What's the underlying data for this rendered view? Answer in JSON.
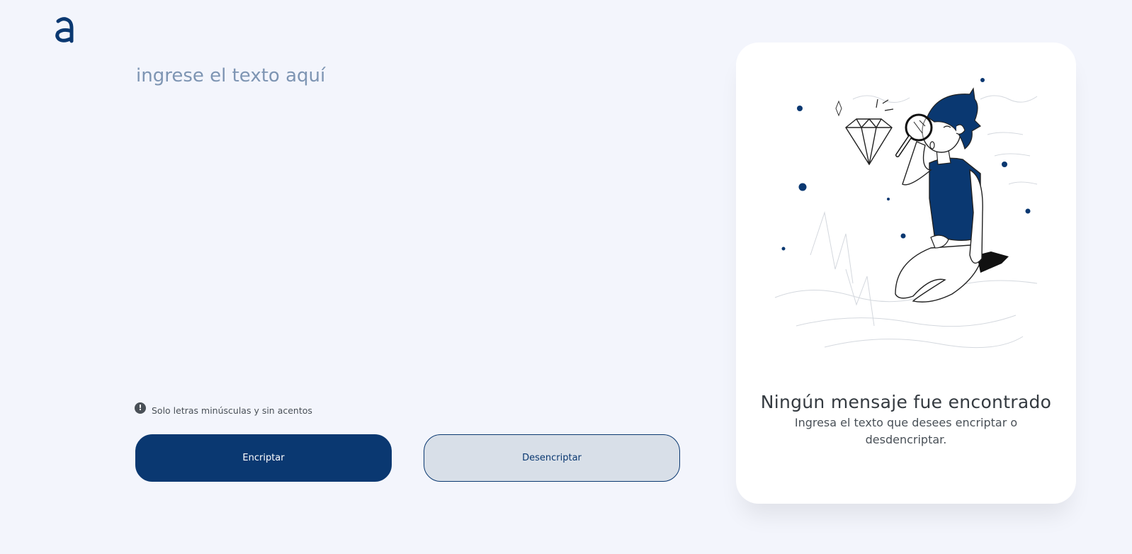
{
  "brand": {
    "logo_letter": "a",
    "logo_icon": "alura-logo-icon",
    "color": "#0a3871"
  },
  "input": {
    "placeholder": "ingrese el texto aquí",
    "value": ""
  },
  "hint": {
    "icon": "exclamation-circle-icon",
    "text": "Solo letras minúsculas y sin acentos"
  },
  "buttons": {
    "encrypt_label": "Encriptar",
    "decrypt_label": "Desencriptar"
  },
  "output": {
    "illustration": "person-with-magnifying-glass-and-diamond-illustration",
    "title": "Ningún mensaje fue encontrado",
    "subtitle": "Ingresa el texto que desees encriptar o desdencriptar."
  },
  "colors": {
    "background": "#f3f5fc",
    "primary": "#0a3871",
    "secondary_button_bg": "#d8dfe8",
    "panel": "#ffffff"
  }
}
